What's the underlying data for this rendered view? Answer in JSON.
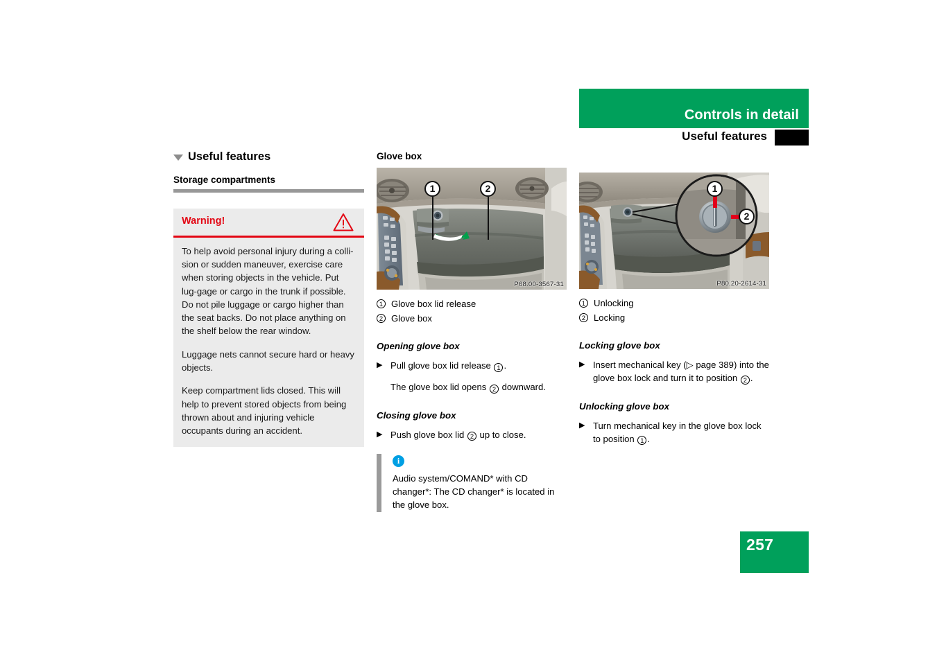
{
  "header": {
    "chapter_title": "Controls in detail",
    "section_title": "Useful features",
    "accent_color": "#00A05B"
  },
  "left_column": {
    "chapter_heading": "Useful features",
    "section_heading": "Storage compartments",
    "warning": {
      "label": "Warning!",
      "label_color": "#e30613",
      "icon": "warning-triangle-icon",
      "paragraphs": [
        "To help avoid personal injury during a colli-sion or sudden maneuver, exercise care when storing objects in the vehicle. Put lug-gage or cargo in the trunk if possible. Do not pile luggage or cargo higher than the seat backs. Do not place anything on the shelf below the rear window.",
        "Luggage nets cannot secure hard or heavy objects.",
        "Keep compartment lids closed. This will help to prevent stored objects from being thrown about and injuring vehicle occupants during an accident."
      ]
    }
  },
  "middle_column": {
    "heading": "Glove box",
    "figure": {
      "code": "P68.00-3567-31",
      "callouts": [
        "1",
        "2"
      ],
      "alt": "glove box in dashboard with lid release"
    },
    "legend": [
      {
        "num": "1",
        "text": "Glove box lid release"
      },
      {
        "num": "2",
        "text": "Glove box"
      }
    ],
    "opening": {
      "heading": "Opening glove box",
      "step_text_a": "Pull glove box lid release ",
      "step_num_a": "1",
      "step_text_a_end": ".",
      "result_a": "The glove box lid opens ",
      "result_num": "2",
      "result_a_end": " downward."
    },
    "closing": {
      "heading": "Closing glove box",
      "step_text_a": "Push glove box lid ",
      "step_num_a": "2",
      "step_text_a_end": " up to close."
    },
    "note": {
      "icon": "info-icon",
      "text": "Audio system/COMAND* with CD changer*: The CD changer* is located in the glove box."
    }
  },
  "right_column": {
    "figure": {
      "code": "P80.20-2614-31",
      "callouts": [
        "1",
        "2"
      ],
      "alt": "glove box lock with magnified key positions"
    },
    "legend": [
      {
        "num": "1",
        "text": "Unlocking"
      },
      {
        "num": "2",
        "text": "Locking"
      }
    ],
    "locking": {
      "heading": "Locking glove box",
      "step_part1": "Insert mechanical key (▷ page 389) into the glove box lock and turn it to position ",
      "step_num": "2",
      "step_part2": "."
    },
    "unlocking": {
      "heading": "Unlocking glove box",
      "step_part1": "Turn mechanical key in the glove box lock to position ",
      "step_num": "1",
      "step_part2": "."
    }
  },
  "footer": {
    "page_number": "257"
  }
}
